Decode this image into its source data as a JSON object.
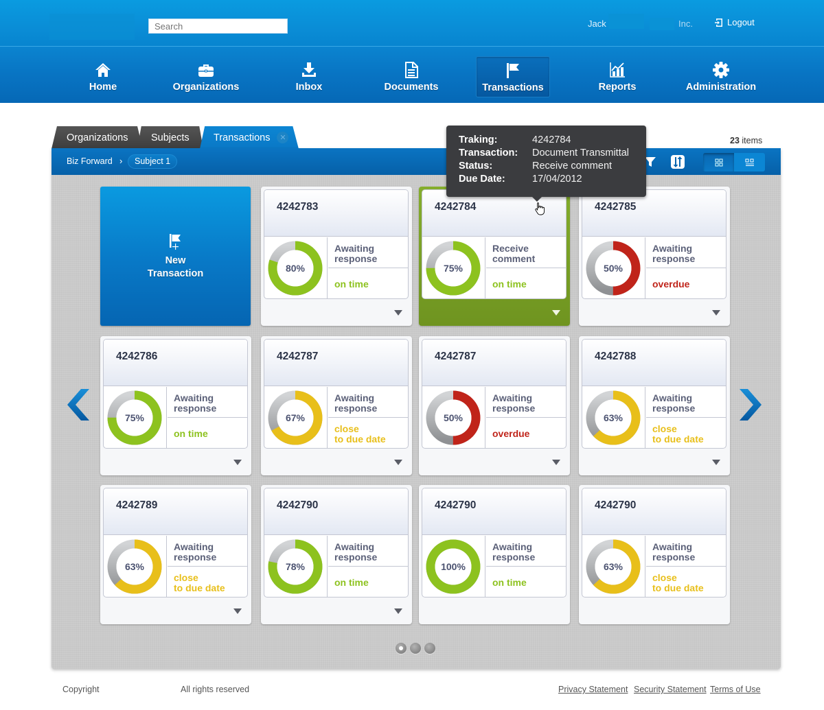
{
  "header": {
    "search_placeholder": "Search",
    "user_name": "Jack",
    "company_suffix": "Inc.",
    "logout_label": "Logout"
  },
  "nav": [
    {
      "label": "Home",
      "icon": "home-icon",
      "active": false
    },
    {
      "label": "Organizations",
      "icon": "briefcase-icon",
      "active": false
    },
    {
      "label": "Inbox",
      "icon": "download-icon",
      "active": false
    },
    {
      "label": "Documents",
      "icon": "document-icon",
      "active": false
    },
    {
      "label": "Transactions",
      "icon": "flag-icon",
      "active": true
    },
    {
      "label": "Reports",
      "icon": "chart-icon",
      "active": false
    },
    {
      "label": "Administration",
      "icon": "gear-icon",
      "active": false
    }
  ],
  "tabs": [
    {
      "label": "Organizations",
      "active": false
    },
    {
      "label": "Subjects",
      "active": false
    },
    {
      "label": "Transactions",
      "active": true,
      "closable": true
    }
  ],
  "breadcrumb": {
    "root": "Biz Forward",
    "current": "Subject 1"
  },
  "items_count": {
    "count": "23",
    "label": "items"
  },
  "toolbar": {
    "filter_icon": "filter-icon",
    "sort_icon": "sort-icon",
    "views": [
      "grid-view",
      "list-view"
    ],
    "active_view": "grid-view"
  },
  "new_tile": {
    "line1": "New",
    "line2": "Transaction"
  },
  "tooltip": {
    "rows": [
      {
        "key": "Traking:",
        "value": "4242784"
      },
      {
        "key": "Transaction:",
        "value": "Document Transmittal"
      },
      {
        "key": "Status:",
        "value": "Receive comment"
      },
      {
        "key": "Due Date:",
        "value": "17/04/2012"
      }
    ]
  },
  "colors": {
    "on_time": "#8dc21f",
    "close": "#e8bf1a",
    "overdue": "#c0241a",
    "track": "#b8babd",
    "brand": "#0a86d2",
    "selected": "#77a024"
  },
  "cards": [
    {
      "id": "4242783",
      "percent": 80,
      "status_line1": "Awaiting",
      "status_line2": "response",
      "timing_line1": "on time",
      "timing_line2": "",
      "state": "on_time",
      "selected": false,
      "has_menu": true
    },
    {
      "id": "4242784",
      "percent": 75,
      "status_line1": "Receive",
      "status_line2": "comment",
      "timing_line1": "on time",
      "timing_line2": "",
      "state": "on_time",
      "selected": true,
      "has_menu": true
    },
    {
      "id": "4242785",
      "percent": 50,
      "status_line1": "Awaiting",
      "status_line2": "response",
      "timing_line1": "overdue",
      "timing_line2": "",
      "state": "overdue",
      "selected": false,
      "has_menu": true
    },
    {
      "id": "4242786",
      "percent": 75,
      "status_line1": "Awaiting",
      "status_line2": "response",
      "timing_line1": "on time",
      "timing_line2": "",
      "state": "on_time",
      "selected": false,
      "has_menu": true
    },
    {
      "id": "4242787",
      "percent": 67,
      "status_line1": "Awaiting",
      "status_line2": "response",
      "timing_line1": "close",
      "timing_line2": "to due date",
      "state": "close",
      "selected": false,
      "has_menu": true
    },
    {
      "id": "4242787",
      "percent": 50,
      "status_line1": "Awaiting",
      "status_line2": "response",
      "timing_line1": "overdue",
      "timing_line2": "",
      "state": "overdue",
      "selected": false,
      "has_menu": true
    },
    {
      "id": "4242788",
      "percent": 63,
      "status_line1": "Awaiting",
      "status_line2": "response",
      "timing_line1": "close",
      "timing_line2": "to due date",
      "state": "close",
      "selected": false,
      "has_menu": true
    },
    {
      "id": "4242789",
      "percent": 63,
      "status_line1": "Awaiting",
      "status_line2": "response",
      "timing_line1": "close",
      "timing_line2": "to due date",
      "state": "close",
      "selected": false,
      "has_menu": true
    },
    {
      "id": "4242790",
      "percent": 78,
      "status_line1": "Awaiting",
      "status_line2": "response",
      "timing_line1": "on time",
      "timing_line2": "",
      "state": "on_time",
      "selected": false,
      "has_menu": true
    },
    {
      "id": "4242790",
      "percent": 100,
      "status_line1": "Awaiting",
      "status_line2": "response",
      "timing_line1": "on time",
      "timing_line2": "",
      "state": "on_time",
      "selected": false,
      "has_menu": false
    },
    {
      "id": "4242790",
      "percent": 63,
      "status_line1": "Awaiting",
      "status_line2": "response",
      "timing_line1": "close",
      "timing_line2": "to due date",
      "state": "close",
      "selected": false,
      "has_menu": false
    }
  ],
  "pagination": {
    "pages": 3,
    "current": 1
  },
  "footer": {
    "copyright": "Copyright",
    "rights": "All rights reserved",
    "links": [
      "Privacy Statement",
      "Security Statement",
      "Terms of Use"
    ]
  }
}
